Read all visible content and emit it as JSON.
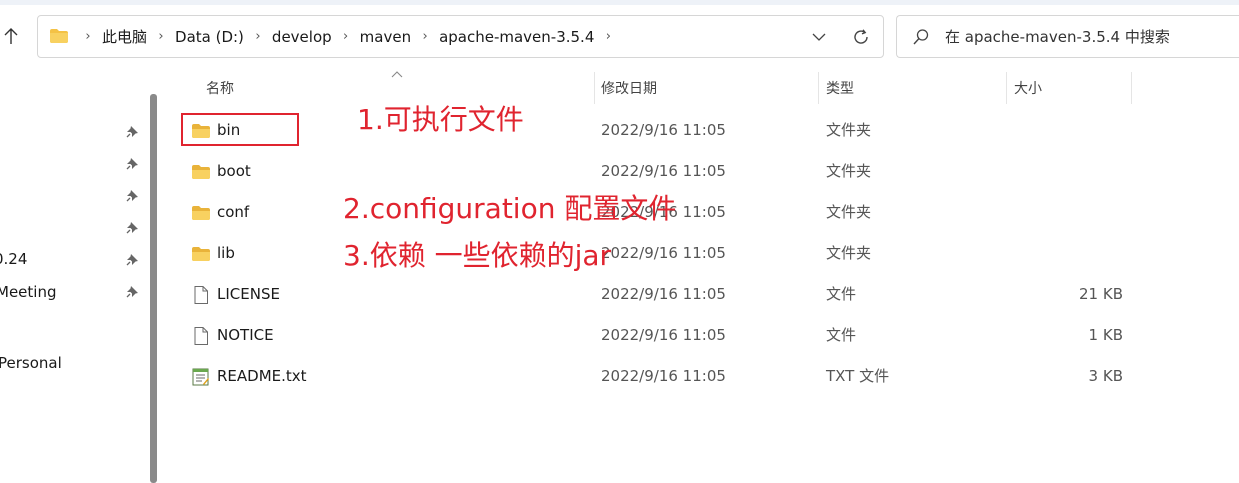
{
  "breadcrumb": [
    "此电脑",
    "Data (D:)",
    "develop",
    "maven",
    "apache-maven-3.5.4"
  ],
  "search": {
    "placeholder": "在 apache-maven-3.5.4 中搜索"
  },
  "nav": {
    "items": [
      {
        "label": "0.24"
      },
      {
        "label": "Meeting"
      },
      {
        "label": " Personal"
      }
    ]
  },
  "columns": {
    "name": "名称",
    "modified": "修改日期",
    "type": "类型",
    "size": "大小"
  },
  "files": [
    {
      "name": "bin",
      "modified": "2022/9/16 11:05",
      "type": "文件夹",
      "size": "",
      "icon": "folder-icon"
    },
    {
      "name": "boot",
      "modified": "2022/9/16 11:05",
      "type": "文件夹",
      "size": "",
      "icon": "folder-icon"
    },
    {
      "name": "conf",
      "modified": "2022/9/16 11:05",
      "type": "文件夹",
      "size": "",
      "icon": "folder-icon"
    },
    {
      "name": "lib",
      "modified": "2022/9/16 11:05",
      "type": "文件夹",
      "size": "",
      "icon": "folder-icon"
    },
    {
      "name": "LICENSE",
      "modified": "2022/9/16 11:05",
      "type": "文件",
      "size": "21 KB",
      "icon": "file-icon"
    },
    {
      "name": "NOTICE",
      "modified": "2022/9/16 11:05",
      "type": "文件",
      "size": "1 KB",
      "icon": "file-icon"
    },
    {
      "name": "README.txt",
      "modified": "2022/9/16 11:05",
      "type": "TXT 文件",
      "size": "3 KB",
      "icon": "text-file-icon"
    }
  ],
  "annotations": [
    "1.可执行文件",
    "2.configuration 配置文件",
    "3.依赖 一些依赖的jar"
  ],
  "colors": {
    "annotation": "#e0242f",
    "folder": "#f4c245"
  }
}
